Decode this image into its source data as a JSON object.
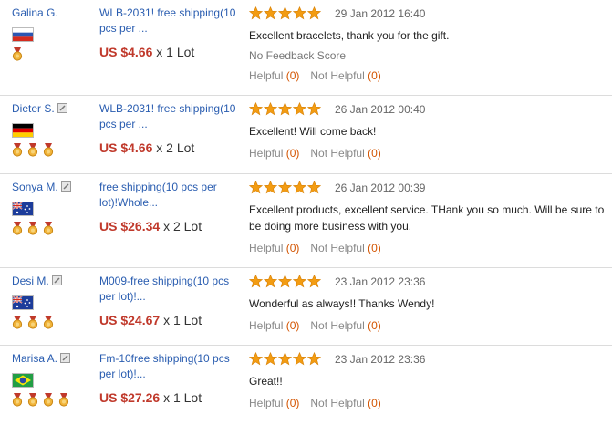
{
  "colors": {
    "link": "#2a5db0",
    "price": "#c0392b",
    "star": "#f39c12",
    "count": "#d35400"
  },
  "reviews": [
    {
      "name": "Galina G.",
      "has_edit_icon": false,
      "country_flag": "russia-flag-icon",
      "medal_count": 1,
      "title": "WLB-2031! free shipping(10 pcs per ...",
      "price": "US $4.66",
      "quantity": "x 1 Lot",
      "rating": 5,
      "date": "29 Jan 2012 16:40",
      "feedback": "Excellent bracelets, thank you for the gift.",
      "no_feedback_score": "No Feedback Score",
      "helpful_label": "Helpful",
      "helpful_count": "(0)",
      "not_helpful_label": "Not Helpful",
      "not_helpful_count": "(0)"
    },
    {
      "name": "Dieter S.",
      "has_edit_icon": true,
      "country_flag": "germany-flag-icon",
      "medal_count": 3,
      "title": "WLB-2031! free shipping(10 pcs per ...",
      "price": "US $4.66",
      "quantity": "x 2 Lot",
      "rating": 5,
      "date": "26 Jan 2012 00:40",
      "feedback": "Excellent! Will come back!",
      "helpful_label": "Helpful",
      "helpful_count": "(0)",
      "not_helpful_label": "Not Helpful",
      "not_helpful_count": "(0)"
    },
    {
      "name": "Sonya M.",
      "has_edit_icon": true,
      "country_flag": "australia-flag-icon",
      "medal_count": 3,
      "title": "free shipping(10 pcs per lot)!Whole...",
      "price": "US $26.34",
      "quantity": "x 2 Lot",
      "rating": 5,
      "date": "26 Jan 2012 00:39",
      "feedback": "Excellent products, excellent service. THank you so much. Will be sure to be doing more business with you.",
      "helpful_label": "Helpful",
      "helpful_count": "(0)",
      "not_helpful_label": "Not Helpful",
      "not_helpful_count": "(0)"
    },
    {
      "name": "Desi M.",
      "has_edit_icon": true,
      "country_flag": "australia-flag-icon",
      "medal_count": 3,
      "title": "M009-free shipping(10 pcs per lot)!...",
      "price": "US $24.67",
      "quantity": "x 1 Lot",
      "rating": 5,
      "date": "23 Jan 2012 23:36",
      "feedback": "Wonderful as always!! Thanks Wendy!",
      "helpful_label": "Helpful",
      "helpful_count": "(0)",
      "not_helpful_label": "Not Helpful",
      "not_helpful_count": "(0)"
    },
    {
      "name": "Marisa A.",
      "has_edit_icon": true,
      "country_flag": "brazil-flag-icon",
      "medal_count": 4,
      "title": "Fm-10free shipping(10 pcs per lot)!...",
      "price": "US $27.26",
      "quantity": "x 1 Lot",
      "rating": 5,
      "date": "23 Jan 2012 23:36",
      "feedback": "Great!!",
      "helpful_label": "Helpful",
      "helpful_count": "(0)",
      "not_helpful_label": "Not Helpful",
      "not_helpful_count": "(0)"
    }
  ]
}
